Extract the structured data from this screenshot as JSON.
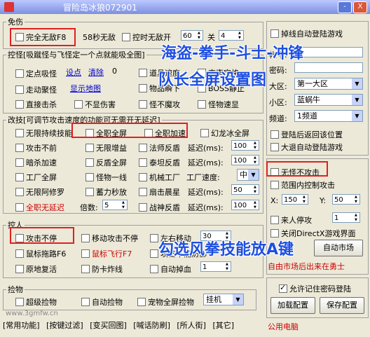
{
  "window": {
    "title": "冒险岛冰狼072901",
    "min_label": "-",
    "close_label": "X"
  },
  "invincible": {
    "legend": "免伤",
    "full_invincible": "完全无敌F8",
    "sec58": "58秒无敌",
    "ctrl_invincible": "控时无敌开",
    "ctrl_value1": "60",
    "ctrl_sep": "关",
    "ctrl_value2": "4"
  },
  "monster_ctrl": {
    "legend": "控怪[吸蹴怪与飞怪定一个点就能吸全图]",
    "fixed_suck": "定点吸怪",
    "set_point": "设点",
    "clear_point": "清除",
    "point_value": "0",
    "walk_gather": "走动聚怪",
    "show_map": "显示地图",
    "prop_speed": "道具速度",
    "change_mode": "变声定格",
    "item_pick": "物品瞬下",
    "boss_freeze": "BOSS静止",
    "direct_kill": "直接击杀",
    "no_hurt": "不显伤害",
    "monster_no_atk": "怪不魔攻",
    "monster_speed": "怪物速显"
  },
  "attack": {
    "legend": "改技[可调节攻击速度的功能可无需开无延迟]",
    "unlimited_skill": "无限持续技能",
    "all_screen": "全职全屏",
    "all_speed": "全职加速",
    "phantom_ice": "幻龙冰全屏",
    "attack_no_forward": "攻击不前",
    "unlimited_boost": "无限增益",
    "mage_reflect": "法师反盾",
    "delay_ms": "延迟(ms):",
    "delay1": "100",
    "dark_accel": "暗杀加速",
    "reflect_accel": "反盾全屏",
    "taie_reflect": "泰坦反盾",
    "delay2": "100",
    "worker_screen": "工厂全屏",
    "monster_line": "怪物一线",
    "mech_factory": "机械工厂",
    "factory_speed": "工厂速度:",
    "factory_speed_val": "中",
    "unlimited_amulet": "无限阿修罗",
    "charge_sec": "蓄力秒放",
    "fan_morning": "扇击晨星",
    "delay_label": "延迟(ms):",
    "delay3": "50",
    "all_no_delay": "全职无延迟",
    "multiplier": "倍数:",
    "multiplier_val": "5",
    "war_reflect": "战神反盾",
    "delay4": "100"
  },
  "control": {
    "legend": "控人",
    "attack_nonstop": "攻击不停",
    "move_attack_nonstop": "移动攻击不停",
    "left_right_move": "左右移动",
    "lr_value": "30",
    "mouse_drag": "鼠标拖路F6",
    "mouse_fly": "鼠标飞行F7",
    "attack_defense": "攻击不能防御",
    "origin_revive": "原地复活",
    "anti_card_crash": "防卡炸线",
    "auto_drop": "自动掉血",
    "drop_value": "1"
  },
  "pickup": {
    "legend": "捡物",
    "super_pick": "超级捡物",
    "auto_pick": "自动捡物",
    "pet_screen_pick": "宠物全屏捡物",
    "mode": "挂机"
  },
  "login": {
    "drop_auto_login": "掉线自动登陆游戏",
    "account_label": "帐号:",
    "password_label": "密码:",
    "server_label": "大区:",
    "server_val": "第一大区",
    "district_label": "小区:",
    "district_val": "蓝蜗牛",
    "channel_label": "频道:",
    "channel_val": "1频道",
    "login_return_pos": "登陆后返回该位置",
    "big_return_login": "大退自动登陆游戏"
  },
  "range": {
    "no_hurt_no_atk": "无怪不攻击",
    "range_ctrl": "范围内控制攻击",
    "x_label": "X:",
    "x_val": "150",
    "y_label": "Y:",
    "y_val": "50",
    "someone_stop": "来人停攻",
    "someone_val": "1",
    "close_directx": "关闭DirectX游戏界面",
    "market_button": "自动市场",
    "market_note": "自由市场后出来在勇士"
  },
  "config": {
    "remember_pwd": "允许记住密码登陆",
    "load_config": "加载配置",
    "save_config": "保存配置",
    "footer_note": "公用电脑"
  },
  "bottom_tabs": [
    "[常用功能]",
    "[按键过滤]",
    "[变买回图]",
    "[喊话防刷]",
    "[所人街]",
    "[其它]"
  ],
  "watermark": "www.3gmfw.cn",
  "overlays": {
    "line1": "海盗-拳手-斗士-冲锋",
    "line2": "队长全屏设置图",
    "line3": "勾选风拳技能放A键"
  },
  "colors": {
    "accent_red": "#e02020",
    "overlay_blue": "#1e4fe0"
  }
}
